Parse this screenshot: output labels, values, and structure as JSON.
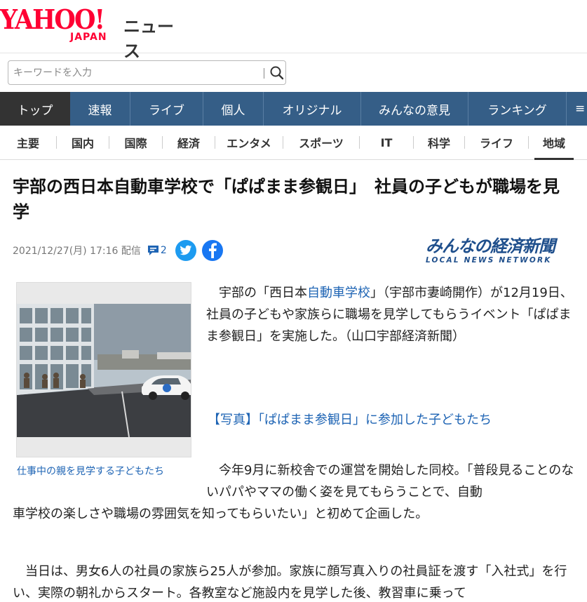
{
  "header": {
    "logo_yahoo": "YAHOO!",
    "logo_japan": "JAPAN",
    "logo_news": "ニュース"
  },
  "search": {
    "placeholder": "キーワードを入力"
  },
  "nav_primary": [
    {
      "label": "トップ",
      "active": true
    },
    {
      "label": "速報"
    },
    {
      "label": "ライブ"
    },
    {
      "label": "個人"
    },
    {
      "label": "オリジナル"
    },
    {
      "label": "みんなの意見"
    },
    {
      "label": "ランキング"
    }
  ],
  "nav_secondary": [
    {
      "label": "主要"
    },
    {
      "label": "国内"
    },
    {
      "label": "国際"
    },
    {
      "label": "経済"
    },
    {
      "label": "エンタメ"
    },
    {
      "label": "スポーツ"
    },
    {
      "label": "IT"
    },
    {
      "label": "科学"
    },
    {
      "label": "ライフ"
    },
    {
      "label": "地域",
      "active": true
    }
  ],
  "article": {
    "title": "宇部の西日本自動車学校で「ぱぱまま参観日」　社員の子どもが職場を見学",
    "date": "2021/12/27(月) 17:16 配信",
    "comment_count": "2",
    "publisher_main": "みんなの経済新聞",
    "publisher_sub": "LOCAL NEWS NETWORK",
    "photo_caption": "仕事中の親を見学する子どもたち",
    "p1_pre": "宇部の「西日本",
    "p1_link": "自動車学校",
    "p1_post": "」（宇部市妻崎開作）が12月19日、社員の子どもや家族らに職場を見学してもらうイベント「ぱぱまま参観日」を実施した。（山口宇部経済新聞）",
    "photo_link": "【写真】「ぱぱまま参観日」に参加した子どもたち",
    "p2_line1": "今年9月に新校舎での運営を開始した同校。「普段見ることのないパパやママの働く姿を見てもらうことで、自動",
    "p2_line2": "車学校の楽しさや職場の雰囲気を知ってもらいたい」と初めて企画した。",
    "p3": "当日は、男女6人の社員の家族ら25人が参加。家族に顔写真入りの社員証を渡す「入社式」を行い、実際の朝礼からスタート。各教室など施設内を見学した後、教習車に乗って"
  },
  "colors": {
    "brand_red": "#ff0033",
    "nav_blue": "#355e87",
    "nav_active": "#333333",
    "link_blue": "#1e64b4",
    "twitter": "#1d9bf0",
    "facebook": "#1877f2"
  },
  "icons": {
    "search": "search-icon",
    "comment": "comment-icon",
    "twitter": "twitter-icon",
    "facebook": "facebook-icon"
  }
}
